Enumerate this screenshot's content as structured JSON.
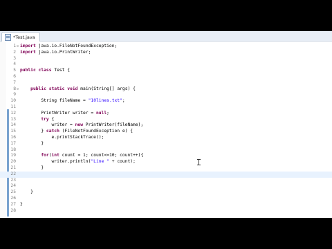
{
  "editor": {
    "tab": {
      "title": "*Test.java",
      "icon": "java-file-icon"
    },
    "lines": [
      {
        "n": "1",
        "fold": "⊖",
        "code": "import java.io.FileNotFoundException;"
      },
      {
        "n": "2",
        "fold": "",
        "code": "import java.io.PrintWriter;"
      },
      {
        "n": "3",
        "fold": "",
        "code": ""
      },
      {
        "n": "4",
        "fold": "",
        "code": ""
      },
      {
        "n": "5",
        "fold": "",
        "code": "public class Test {"
      },
      {
        "n": "6",
        "fold": "",
        "code": ""
      },
      {
        "n": "7",
        "fold": "",
        "code": ""
      },
      {
        "n": "8",
        "fold": "⊖",
        "code": "    public static void main(String[] args) {"
      },
      {
        "n": "9",
        "fold": "",
        "code": ""
      },
      {
        "n": "10",
        "fold": "",
        "code": "        String fileName = \"10lines.txt\";"
      },
      {
        "n": "11",
        "fold": "",
        "code": ""
      },
      {
        "n": "12",
        "fold": "",
        "code": "        PrintWriter writer = null;"
      },
      {
        "n": "13",
        "fold": "",
        "code": "        try {"
      },
      {
        "n": "14",
        "fold": "",
        "code": "            writer = new PrintWriter(fileName);"
      },
      {
        "n": "15",
        "fold": "",
        "code": "        } catch (FileNotFoundException e) {"
      },
      {
        "n": "16",
        "fold": "",
        "code": "            e.printStackTrace();"
      },
      {
        "n": "17",
        "fold": "",
        "code": "        }"
      },
      {
        "n": "18",
        "fold": "",
        "code": ""
      },
      {
        "n": "19",
        "fold": "",
        "code": "        for(int count = 1; count<=10; count++){"
      },
      {
        "n": "20",
        "fold": "",
        "code": "            writer.println(\"Line \" + count);"
      },
      {
        "n": "21",
        "fold": "",
        "code": "        }"
      },
      {
        "n": "22",
        "fold": "",
        "code": ""
      },
      {
        "n": "23",
        "fold": "",
        "code": ""
      },
      {
        "n": "24",
        "fold": "",
        "code": ""
      },
      {
        "n": "25",
        "fold": "",
        "code": "    }"
      },
      {
        "n": "26",
        "fold": "",
        "code": ""
      },
      {
        "n": "27",
        "fold": "",
        "code": "}"
      },
      {
        "n": "28",
        "fold": "",
        "code": ""
      }
    ],
    "current_line": "22"
  },
  "colors": {
    "keyword": "#7f0055",
    "string": "#2a00ff",
    "field": "#0000c0",
    "line_number": "#7d7d7d",
    "current_line_bg": "#e8f2fe"
  }
}
